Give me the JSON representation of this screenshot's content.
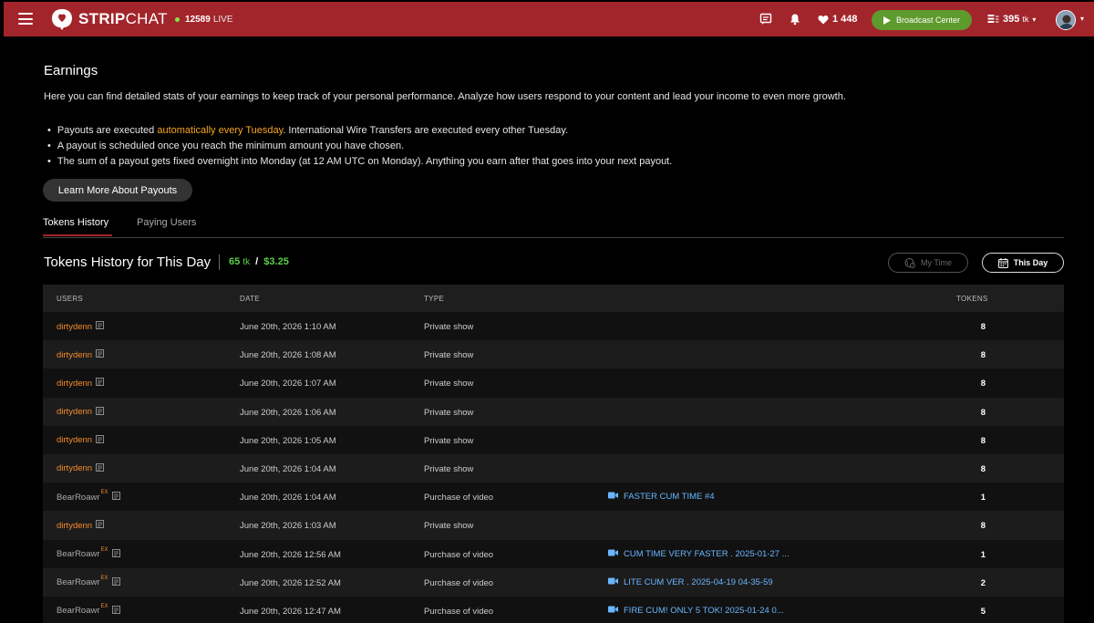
{
  "header": {
    "brand_bold": "STRIP",
    "brand_light": "CHAT",
    "live_count": "12589",
    "live_word": "LIVE",
    "likes": "1 448",
    "broadcast_label": "Broadcast Center",
    "token_balance": "395",
    "token_unit": "tk",
    "colors": {
      "bar": "#a2252b",
      "broadcast": "#5f9a2d",
      "live_dot": "#8ee04a"
    }
  },
  "page": {
    "title": "Earnings",
    "intro": "Here you can find detailed stats of your earnings to keep track of your personal performance. Analyze how users respond to your content and lead your income to even more growth.",
    "bullets": [
      {
        "pre": "Payouts are executed ",
        "highlight": "automatically every Tuesday",
        "post": ". International Wire Transfers are executed every other Tuesday."
      },
      {
        "pre": "A payout is scheduled once you reach the minimum amount you have chosen.",
        "highlight": "",
        "post": ""
      },
      {
        "pre": "The sum of a payout gets fixed overnight into Monday (at 12 AM UTC on Monday). Anything you earn after that goes into your next payout.",
        "highlight": "",
        "post": ""
      }
    ],
    "learn_more": "Learn More About Payouts",
    "tabs": [
      "Tokens History",
      "Paying Users"
    ],
    "active_tab": "Tokens History"
  },
  "history": {
    "title": "Tokens History for This Day",
    "total_tokens": "65",
    "total_unit": "tk",
    "total_sep": "/",
    "total_usd": "$3.25",
    "btn_my_time": "My Time",
    "btn_this_day": "This Day",
    "columns": {
      "users": "USERS",
      "date": "DATE",
      "type": "TYPE",
      "tokens": "TOKENS"
    },
    "rows": [
      {
        "user": "dirtydenn",
        "ex": "",
        "date": "June 20th, 2026 1:10 AM",
        "type": "Private show",
        "video": "",
        "tokens": "8"
      },
      {
        "user": "dirtydenn",
        "ex": "",
        "date": "June 20th, 2026 1:08 AM",
        "type": "Private show",
        "video": "",
        "tokens": "8"
      },
      {
        "user": "dirtydenn",
        "ex": "",
        "date": "June 20th, 2026 1:07 AM",
        "type": "Private show",
        "video": "",
        "tokens": "8"
      },
      {
        "user": "dirtydenn",
        "ex": "",
        "date": "June 20th, 2026 1:06 AM",
        "type": "Private show",
        "video": "",
        "tokens": "8"
      },
      {
        "user": "dirtydenn",
        "ex": "",
        "date": "June 20th, 2026 1:05 AM",
        "type": "Private show",
        "video": "",
        "tokens": "8"
      },
      {
        "user": "dirtydenn",
        "ex": "",
        "date": "June 20th, 2026 1:04 AM",
        "type": "Private show",
        "video": "",
        "tokens": "8"
      },
      {
        "user": "BearRoawr",
        "ex": "EX",
        "date": "June 20th, 2026 1:04 AM",
        "type": "Purchase of video",
        "video": "FASTER CUM TIME #4",
        "tokens": "1"
      },
      {
        "user": "dirtydenn",
        "ex": "",
        "date": "June 20th, 2026 1:03 AM",
        "type": "Private show",
        "video": "",
        "tokens": "8"
      },
      {
        "user": "BearRoawr",
        "ex": "EX",
        "date": "June 20th, 2026 12:56 AM",
        "type": "Purchase of video",
        "video": "CUM TIME VERY FASTER . 2025-01-27 ...",
        "tokens": "1"
      },
      {
        "user": "BearRoawr",
        "ex": "EX",
        "date": "June 20th, 2026 12:52 AM",
        "type": "Purchase of video",
        "video": "LITE CUM VER . 2025-04-19 04-35-59",
        "tokens": "2"
      },
      {
        "user": "BearRoawr",
        "ex": "EX",
        "date": "June 20th, 2026 12:47 AM",
        "type": "Purchase of video",
        "video": "FIRE CUM! ONLY 5 TOK! 2025-01-24 0...",
        "tokens": "5"
      }
    ]
  }
}
